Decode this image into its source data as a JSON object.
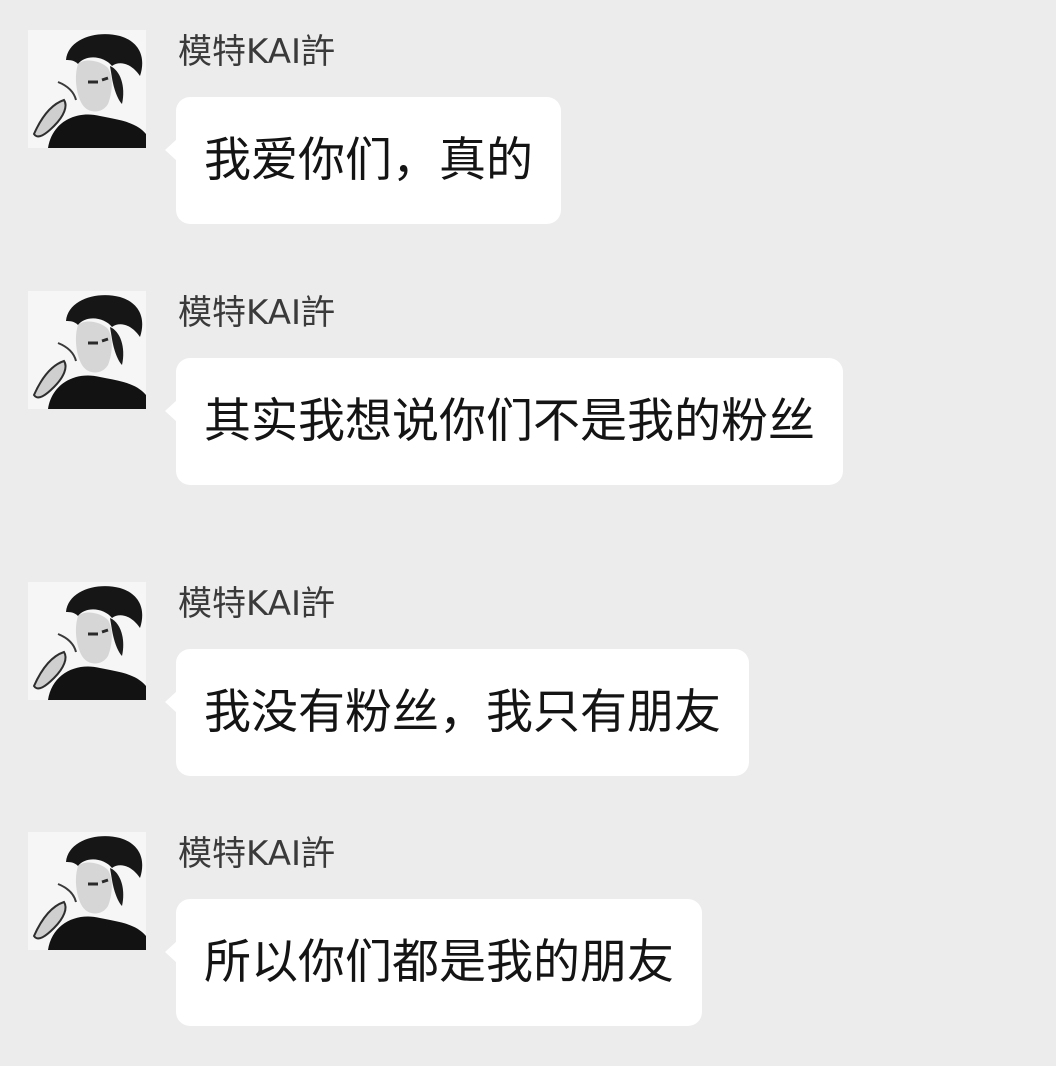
{
  "messages": [
    {
      "sender": "模特KAI許",
      "text": "我爱你们，真的"
    },
    {
      "sender": "模特KAI許",
      "text": "其实我想说你们不是我的粉丝"
    },
    {
      "sender": "模特KAI許",
      "text": "我没有粉丝，我只有朋友"
    },
    {
      "sender": "模特KAI許",
      "text": "所以你们都是我的朋友"
    }
  ]
}
